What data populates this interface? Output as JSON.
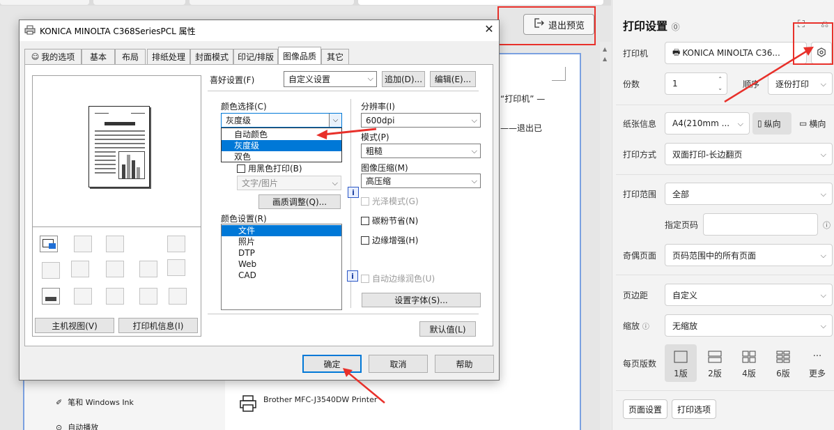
{
  "exit_preview": {
    "label": "退出预览"
  },
  "preview": {
    "line1": "“打印机” —",
    "line2": "——退出已",
    "sidebar_item_pen": "笔和 Windows Ink",
    "sidebar_item_autoplay": "自动播放",
    "printer_item": "Brother MFC-J3540DW Printer"
  },
  "right_panel": {
    "title": "打印设置",
    "printer": {
      "label": "打印机",
      "value": "KONICA MINOLTA C36..."
    },
    "copies": {
      "label": "份数",
      "value": "1",
      "order_label": "顺序",
      "order_value": "逐份打印"
    },
    "paper": {
      "label": "纸张信息",
      "value": "A4(210mm ...",
      "portrait": "纵向",
      "landscape": "横向"
    },
    "print_mode": {
      "label": "打印方式",
      "value": "双面打印-长边翻页"
    },
    "print_range": {
      "label": "打印范围",
      "value": "全部",
      "pages_label": "指定页码",
      "pages_value": ""
    },
    "odd_even": {
      "label": "奇偶页面",
      "value": "页码范围中的所有页面"
    },
    "margin": {
      "label": "页边距",
      "value": "自定义"
    },
    "scale": {
      "label": "缩放",
      "value": "无缩放"
    },
    "pages_per_sheet": {
      "label": "每页版数",
      "options": [
        "1版",
        "2版",
        "4版",
        "6版",
        "更多"
      ],
      "selected": "1版"
    },
    "page_setup_btn": "页面设置",
    "print_options_btn": "打印选项"
  },
  "dialog": {
    "title": "KONICA MINOLTA C368SeriesPCL 属性",
    "tabs": [
      "我的选项",
      "基本",
      "布局",
      "排纸处理",
      "封面模式",
      "印记/排版",
      "图像品质",
      "其它"
    ],
    "active_tab": "图像品质",
    "favorite": {
      "label": "喜好设置(F)",
      "value": "自定义设置",
      "add_btn": "追加(D)...",
      "edit_btn": "编辑(E)..."
    },
    "color_select": {
      "label": "颜色选择(C)",
      "value": "灰度级",
      "options": [
        "自动颜色",
        "灰度级",
        "双色"
      ],
      "selected": "灰度级"
    },
    "black_print": {
      "label": "用黑色打印(B)",
      "value": "文字/图片"
    },
    "quality_adjust_btn": "画质调整(Q)...",
    "color_settings": {
      "label": "颜色设置(R)",
      "items": [
        "文件",
        "照片",
        "DTP",
        "Web",
        "CAD"
      ],
      "selected": "文件"
    },
    "resolution": {
      "label": "分辨率(I)",
      "value": "600dpi"
    },
    "pattern": {
      "label": "模式(P)",
      "value": "粗糙"
    },
    "compression": {
      "label": "图像压缩(M)",
      "value": "高压缩"
    },
    "gloss": "光泽模式(G)",
    "toner_save": "碳粉节省(N)",
    "edge_enhance": "边缘增强(H)",
    "auto_trapping": "自动边缘润色(U)",
    "font_settings_btn": "设置字体(S)...",
    "host_view_btn": "主机视图(V)",
    "printer_info_btn": "打印机信息(I)",
    "default_btn": "默认值(L)",
    "ok_btn": "确定",
    "cancel_btn": "取消",
    "help_btn": "帮助"
  }
}
